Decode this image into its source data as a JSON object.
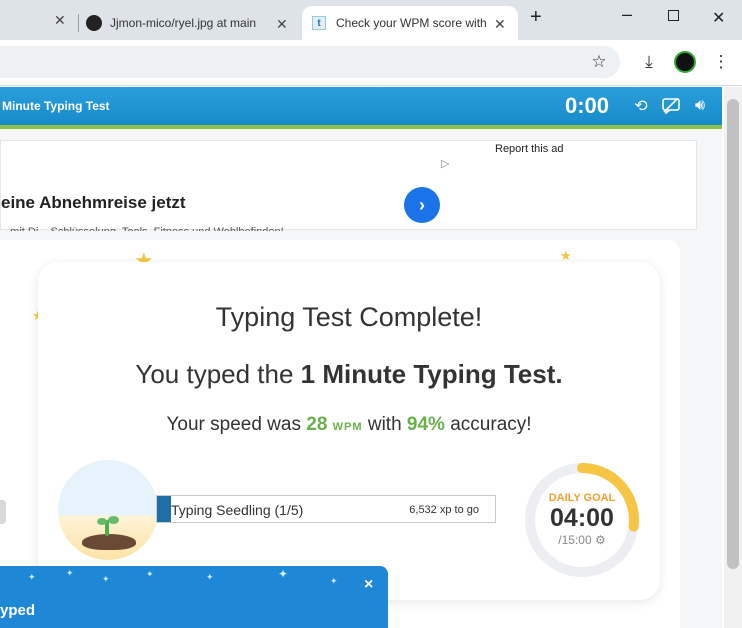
{
  "browser": {
    "tabs": [
      {
        "title": "",
        "active": false
      },
      {
        "title": "Jjmon-mico/ryel.jpg at main",
        "active": false
      },
      {
        "title": "Check your WPM score with",
        "active": true
      }
    ],
    "new_tab_glyph": "+",
    "window_controls": [
      "minimize-icon",
      "restore-icon",
      "close-icon"
    ],
    "toolbar_icons": [
      "star-icon",
      "download-icon",
      "avatar",
      "kebab-menu-icon"
    ]
  },
  "site": {
    "header_title": "Minute Typing Test",
    "timer": "0:00",
    "header_icons": [
      "history-icon",
      "comment-off-icon",
      "volume-icon"
    ]
  },
  "ad": {
    "report_label": "Report this ad",
    "headline": "eine Abnehmreise jetzt",
    "subline": "...mit Di... Schlüsselung, Tools, Fitness und Wohlbefinden!"
  },
  "result": {
    "title": "Typing Test Complete!",
    "subtitle_prefix": "You typed the ",
    "subtitle_bold": "1 Minute Typing Test.",
    "speed_prefix": "Your speed was ",
    "wpm_value": "28",
    "wpm_unit": "WPM",
    "speed_middle": " with ",
    "accuracy": "94%",
    "speed_suffix": " accuracy!"
  },
  "level": {
    "name": "Typing Seedling (1/5)",
    "xp_to_go": "6,532 xp to go",
    "progress": 0.04
  },
  "daily_goal": {
    "label": "DAILY GOAL",
    "time": "04:00",
    "total": "/15:00",
    "progress": 0.27,
    "accent": "#f7c544"
  },
  "popup": {
    "title": "yped",
    "close_label": "×"
  },
  "colors": {
    "header_blue": "#1e95d4",
    "header_green": "#8bc34a",
    "accent_green": "#6ab04c",
    "level_fill": "#1f6ea8"
  }
}
